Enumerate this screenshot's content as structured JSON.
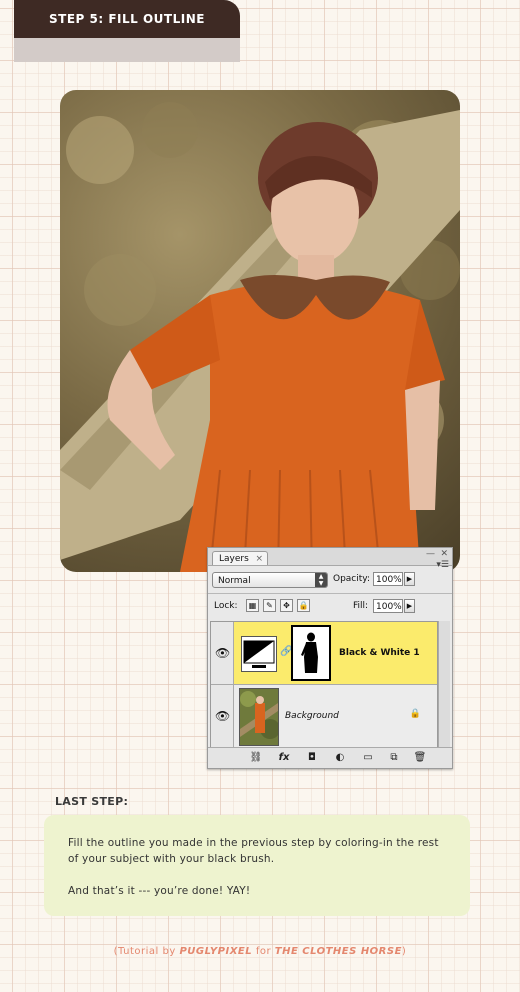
{
  "header": {
    "step_label": "STEP 5: FILL OUTLINE"
  },
  "layers_panel": {
    "tab_label": "Layers",
    "tab_close": "×",
    "blend_mode": "Normal",
    "opacity_label": "Opacity:",
    "opacity_value": "100%",
    "lock_label": "Lock:",
    "fill_label": "Fill:",
    "fill_value": "100%",
    "layers": [
      {
        "name": "Black & White 1",
        "selected": true
      },
      {
        "name": "Background",
        "selected": false
      }
    ],
    "footer_icons": [
      "link-icon",
      "fx-icon",
      "mask-icon",
      "adjustment-icon",
      "folder-icon",
      "new-layer-icon",
      "trash-icon"
    ]
  },
  "last_step": {
    "title": "LAST STEP:",
    "paragraph1": "Fill the outline you made in the previous step by coloring-in the rest of your subject with your black brush.",
    "paragraph2": "And that’s it --- you’re done! YAY!"
  },
  "credit": {
    "prefix": "(Tutorial by ",
    "author": "PUGLYPIXEL",
    "middle": " for ",
    "site": "THE CLOTHES HORSE",
    "suffix": ")"
  },
  "colors": {
    "tab_bg": "#3e2a24",
    "selected_layer": "#fbeb6c",
    "note_bg": "#eef3cf",
    "credit_text": "#e4876e",
    "dress": "#d9641f"
  }
}
